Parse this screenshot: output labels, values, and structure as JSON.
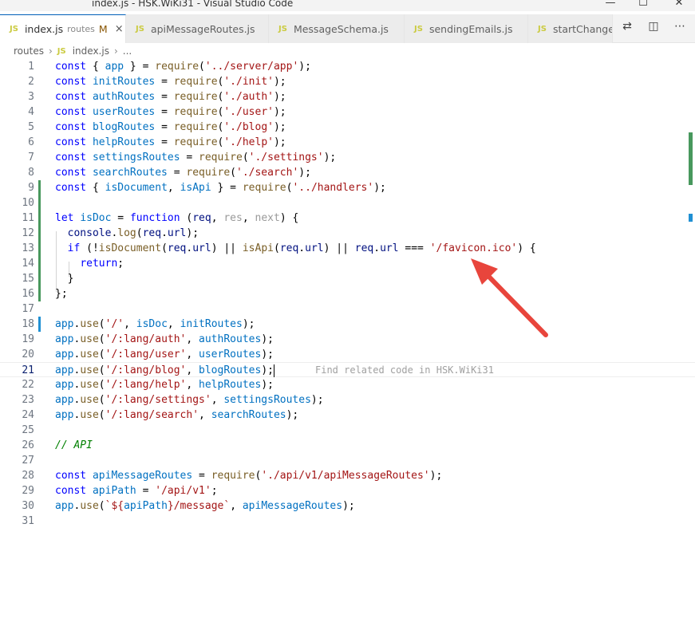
{
  "window": {
    "title": "index.js - HSK.WiKi31 - Visual Studio Code",
    "controls": [
      "minimize-icon",
      "maximize-icon",
      "close-icon"
    ]
  },
  "tabs": [
    {
      "label": "index.js",
      "description": "routes",
      "modified": "M",
      "active": true
    },
    {
      "label": "apiMessageRoutes.js",
      "active": false
    },
    {
      "label": "MessageSchema.js",
      "active": false
    },
    {
      "label": "sendingEmails.js",
      "active": false
    },
    {
      "label": "startChangeP",
      "active": false
    }
  ],
  "tab_icon": "JS",
  "tab_close": "×",
  "toolbar": {
    "icons": [
      "compare-changes-icon",
      "split-editor-icon",
      "more-actions-icon"
    ]
  },
  "breadcrumb": {
    "folder": "routes",
    "file": "index.js",
    "symbol": "..."
  },
  "editor": {
    "current_line": 21,
    "inline_hint": "Find related code in HSK.WiKi31",
    "line_numbers": [
      "1",
      "2",
      "3",
      "4",
      "5",
      "6",
      "7",
      "8",
      "9",
      "10",
      "11",
      "12",
      "13",
      "14",
      "15",
      "16",
      "17",
      "18",
      "19",
      "20",
      "21",
      "22",
      "23",
      "24",
      "25",
      "26",
      "27",
      "28",
      "29",
      "30",
      "31"
    ],
    "colors": {
      "keyword": "#0000ff",
      "variable": "#0070c1",
      "function": "#795e26",
      "string": "#a31515",
      "comment": "#008000",
      "added": "#48985d",
      "modified": "#2090d3",
      "annotation_arrow": "#e8453c"
    }
  },
  "code": [
    [
      [
        "k",
        "const"
      ],
      [
        "t",
        " { "
      ],
      [
        "v",
        "app"
      ],
      [
        "t",
        " } = "
      ],
      [
        "f",
        "require"
      ],
      [
        "t",
        "("
      ],
      [
        "s",
        "'../server/app'"
      ],
      [
        "t",
        ");"
      ]
    ],
    [
      [
        "k",
        "const"
      ],
      [
        "t",
        " "
      ],
      [
        "v",
        "initRoutes"
      ],
      [
        "t",
        " = "
      ],
      [
        "f",
        "require"
      ],
      [
        "t",
        "("
      ],
      [
        "s",
        "'./init'"
      ],
      [
        "t",
        ");"
      ]
    ],
    [
      [
        "k",
        "const"
      ],
      [
        "t",
        " "
      ],
      [
        "v",
        "authRoutes"
      ],
      [
        "t",
        " = "
      ],
      [
        "f",
        "require"
      ],
      [
        "t",
        "("
      ],
      [
        "s",
        "'./auth'"
      ],
      [
        "t",
        ");"
      ]
    ],
    [
      [
        "k",
        "const"
      ],
      [
        "t",
        " "
      ],
      [
        "v",
        "userRoutes"
      ],
      [
        "t",
        " = "
      ],
      [
        "f",
        "require"
      ],
      [
        "t",
        "("
      ],
      [
        "s",
        "'./user'"
      ],
      [
        "t",
        ");"
      ]
    ],
    [
      [
        "k",
        "const"
      ],
      [
        "t",
        " "
      ],
      [
        "v",
        "blogRoutes"
      ],
      [
        "t",
        " = "
      ],
      [
        "f",
        "require"
      ],
      [
        "t",
        "("
      ],
      [
        "s",
        "'./blog'"
      ],
      [
        "t",
        ");"
      ]
    ],
    [
      [
        "k",
        "const"
      ],
      [
        "t",
        " "
      ],
      [
        "v",
        "helpRoutes"
      ],
      [
        "t",
        " = "
      ],
      [
        "f",
        "require"
      ],
      [
        "t",
        "("
      ],
      [
        "s",
        "'./help'"
      ],
      [
        "t",
        ");"
      ]
    ],
    [
      [
        "k",
        "const"
      ],
      [
        "t",
        " "
      ],
      [
        "v",
        "settingsRoutes"
      ],
      [
        "t",
        " = "
      ],
      [
        "f",
        "require"
      ],
      [
        "t",
        "("
      ],
      [
        "s",
        "'./settings'"
      ],
      [
        "t",
        ");"
      ]
    ],
    [
      [
        "k",
        "const"
      ],
      [
        "t",
        " "
      ],
      [
        "v",
        "searchRoutes"
      ],
      [
        "t",
        " = "
      ],
      [
        "f",
        "require"
      ],
      [
        "t",
        "("
      ],
      [
        "s",
        "'./search'"
      ],
      [
        "t",
        ");"
      ]
    ],
    [
      [
        "k",
        "const"
      ],
      [
        "t",
        " { "
      ],
      [
        "v",
        "isDocument"
      ],
      [
        "t",
        ", "
      ],
      [
        "v",
        "isApi"
      ],
      [
        "t",
        " } = "
      ],
      [
        "f",
        "require"
      ],
      [
        "t",
        "("
      ],
      [
        "s",
        "'../handlers'"
      ],
      [
        "t",
        ");"
      ]
    ],
    [],
    [
      [
        "k",
        "let"
      ],
      [
        "t",
        " "
      ],
      [
        "v",
        "isDoc"
      ],
      [
        "t",
        " = "
      ],
      [
        "k",
        "function"
      ],
      [
        "t",
        " ("
      ],
      [
        "p",
        "req"
      ],
      [
        "t",
        ", "
      ],
      [
        "dim",
        "res"
      ],
      [
        "t",
        ", "
      ],
      [
        "dim",
        "next"
      ],
      [
        "t",
        ") {"
      ]
    ],
    [
      [
        "t",
        "  "
      ],
      [
        "p",
        "console"
      ],
      [
        "t",
        "."
      ],
      [
        "f",
        "log"
      ],
      [
        "t",
        "("
      ],
      [
        "p",
        "req"
      ],
      [
        "t",
        "."
      ],
      [
        "p",
        "url"
      ],
      [
        "t",
        ");"
      ]
    ],
    [
      [
        "t",
        "  "
      ],
      [
        "k",
        "if"
      ],
      [
        "t",
        " (!"
      ],
      [
        "f",
        "isDocument"
      ],
      [
        "t",
        "("
      ],
      [
        "p",
        "req"
      ],
      [
        "t",
        "."
      ],
      [
        "p",
        "url"
      ],
      [
        "t",
        ") || "
      ],
      [
        "f",
        "isApi"
      ],
      [
        "t",
        "("
      ],
      [
        "p",
        "req"
      ],
      [
        "t",
        "."
      ],
      [
        "p",
        "url"
      ],
      [
        "t",
        ") || "
      ],
      [
        "p",
        "req"
      ],
      [
        "t",
        "."
      ],
      [
        "p",
        "url"
      ],
      [
        "t",
        " === "
      ],
      [
        "s",
        "'/favicon.ico'"
      ],
      [
        "t",
        ") {"
      ]
    ],
    [
      [
        "t",
        "    "
      ],
      [
        "k",
        "return"
      ],
      [
        "t",
        ";"
      ]
    ],
    [
      [
        "t",
        "  }"
      ]
    ],
    [
      [
        "t",
        "};"
      ]
    ],
    [],
    [
      [
        "v",
        "app"
      ],
      [
        "t",
        "."
      ],
      [
        "f",
        "use"
      ],
      [
        "t",
        "("
      ],
      [
        "s",
        "'/'"
      ],
      [
        "t",
        ", "
      ],
      [
        "v",
        "isDoc"
      ],
      [
        "t",
        ", "
      ],
      [
        "v",
        "initRoutes"
      ],
      [
        "t",
        ");"
      ]
    ],
    [
      [
        "v",
        "app"
      ],
      [
        "t",
        "."
      ],
      [
        "f",
        "use"
      ],
      [
        "t",
        "("
      ],
      [
        "s",
        "'/:lang/auth'"
      ],
      [
        "t",
        ", "
      ],
      [
        "v",
        "authRoutes"
      ],
      [
        "t",
        ");"
      ]
    ],
    [
      [
        "v",
        "app"
      ],
      [
        "t",
        "."
      ],
      [
        "f",
        "use"
      ],
      [
        "t",
        "("
      ],
      [
        "s",
        "'/:lang/user'"
      ],
      [
        "t",
        ", "
      ],
      [
        "v",
        "userRoutes"
      ],
      [
        "t",
        ");"
      ]
    ],
    [
      [
        "v",
        "app"
      ],
      [
        "t",
        "."
      ],
      [
        "f",
        "use"
      ],
      [
        "t",
        "("
      ],
      [
        "s",
        "'/:lang/blog'"
      ],
      [
        "t",
        ", "
      ],
      [
        "v",
        "blogRoutes"
      ],
      [
        "t",
        ");"
      ]
    ],
    [
      [
        "v",
        "app"
      ],
      [
        "t",
        "."
      ],
      [
        "f",
        "use"
      ],
      [
        "t",
        "("
      ],
      [
        "s",
        "'/:lang/help'"
      ],
      [
        "t",
        ", "
      ],
      [
        "v",
        "helpRoutes"
      ],
      [
        "t",
        ");"
      ]
    ],
    [
      [
        "v",
        "app"
      ],
      [
        "t",
        "."
      ],
      [
        "f",
        "use"
      ],
      [
        "t",
        "("
      ],
      [
        "s",
        "'/:lang/settings'"
      ],
      [
        "t",
        ", "
      ],
      [
        "v",
        "settingsRoutes"
      ],
      [
        "t",
        ");"
      ]
    ],
    [
      [
        "v",
        "app"
      ],
      [
        "t",
        "."
      ],
      [
        "f",
        "use"
      ],
      [
        "t",
        "("
      ],
      [
        "s",
        "'/:lang/search'"
      ],
      [
        "t",
        ", "
      ],
      [
        "v",
        "searchRoutes"
      ],
      [
        "t",
        ");"
      ]
    ],
    [],
    [
      [
        "c",
        "// API"
      ]
    ],
    [],
    [
      [
        "k",
        "const"
      ],
      [
        "t",
        " "
      ],
      [
        "v",
        "apiMessageRoutes"
      ],
      [
        "t",
        " = "
      ],
      [
        "f",
        "require"
      ],
      [
        "t",
        "("
      ],
      [
        "s",
        "'./api/v1/apiMessageRoutes'"
      ],
      [
        "t",
        ");"
      ]
    ],
    [
      [
        "k",
        "const"
      ],
      [
        "t",
        " "
      ],
      [
        "v",
        "apiPath"
      ],
      [
        "t",
        " = "
      ],
      [
        "s",
        "'/api/v1'"
      ],
      [
        "t",
        ";"
      ]
    ],
    [
      [
        "v",
        "app"
      ],
      [
        "t",
        "."
      ],
      [
        "f",
        "use"
      ],
      [
        "t",
        "("
      ],
      [
        "s",
        "`${"
      ],
      [
        "v",
        "apiPath"
      ],
      [
        "s",
        "}/message`"
      ],
      [
        "t",
        ", "
      ],
      [
        "v",
        "apiMessageRoutes"
      ],
      [
        "t",
        ");"
      ]
    ],
    []
  ],
  "gutter": [
    "",
    "",
    "",
    "",
    "",
    "",
    "",
    "",
    "add",
    "add",
    "add",
    "add",
    "add",
    "add",
    "add",
    "add",
    "",
    "mod",
    "",
    "",
    "",
    "",
    "",
    "",
    "",
    "",
    "",
    "",
    "",
    "",
    ""
  ]
}
